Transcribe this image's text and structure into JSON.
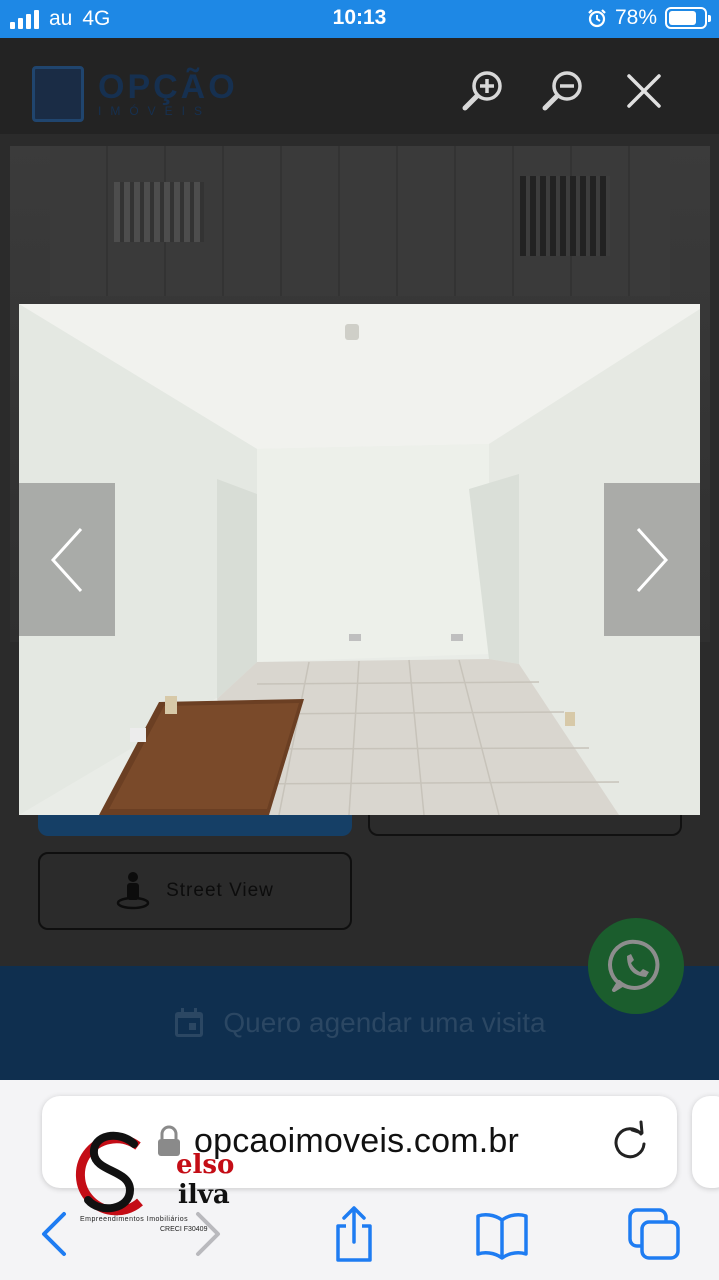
{
  "status_bar": {
    "carrier": "au",
    "network": "4G",
    "time": "10:13",
    "battery": "78%",
    "battery_level": 0.78,
    "icons": [
      "signal-icon",
      "alarm-icon",
      "battery-icon"
    ]
  },
  "site": {
    "logo_name": "OPÇÃO",
    "logo_tagline": "IMÓVEIS",
    "viewer_controls": [
      "zoom-in-icon",
      "zoom-out-icon",
      "close-icon"
    ]
  },
  "lightbox": {
    "prev_icon": "chevron-left-icon",
    "next_icon": "chevron-right-icon",
    "photo_subject": "empty white room with tiled floor"
  },
  "page": {
    "street_view_label": "Street View",
    "schedule_label": "Quero agendar uma visita",
    "whatsapp_icon": "whatsapp-icon"
  },
  "browser": {
    "url": "opcaoimoveis.com.br",
    "toolbar_icons": [
      "back-icon",
      "forward-icon",
      "share-icon",
      "bookmarks-icon",
      "tabs-icon"
    ]
  },
  "watermark": {
    "name_part_1": "elso",
    "name_part_2": "ilva",
    "subtitle": "Empreendimentos Imobiliários",
    "creci": "CRECI F30409"
  },
  "colors": {
    "status_bar": "#1e88e5",
    "brand_dark": "#0f2f4f",
    "whatsapp": "#1b5d2d",
    "watermark_red": "#c40d16"
  }
}
